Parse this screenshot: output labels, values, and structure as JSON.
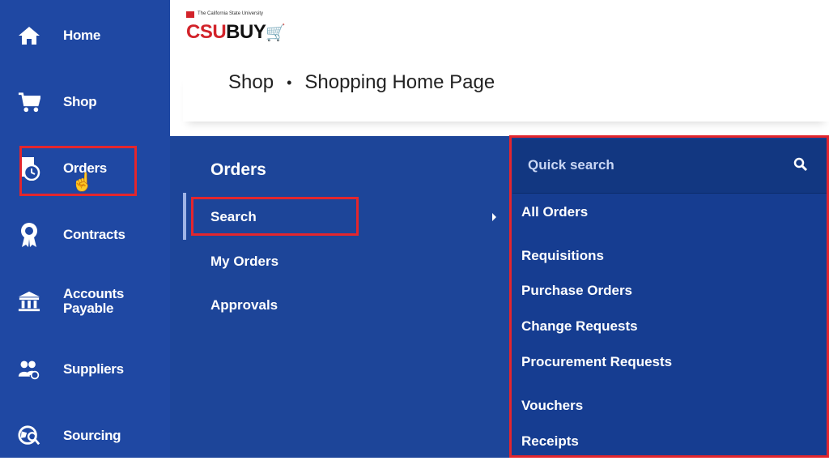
{
  "sidebar": {
    "items": [
      {
        "label": "Home",
        "icon": "home-icon"
      },
      {
        "label": "Shop",
        "icon": "cart-icon"
      },
      {
        "label": "Orders",
        "icon": "orders-clock-icon"
      },
      {
        "label": "Contracts",
        "icon": "award-ribbon-icon"
      },
      {
        "label": "Accounts Payable",
        "icon": "bank-icon"
      },
      {
        "label": "Suppliers",
        "icon": "suppliers-group-icon"
      },
      {
        "label": "Sourcing",
        "icon": "globe-search-icon"
      }
    ]
  },
  "header": {
    "logo_text_csu": "CSU",
    "logo_text_buy": "BUY",
    "logo_tagline": "The California State University",
    "breadcrumb": [
      "Shop",
      "Shopping Home Page"
    ]
  },
  "orders_menu": {
    "title": "Orders",
    "items": [
      "Search",
      "My Orders",
      "Approvals"
    ]
  },
  "flyout": {
    "search_placeholder": "Quick search",
    "items": [
      "All Orders",
      "Requisitions",
      "Purchase Orders",
      "Change Requests",
      "Procurement Requests",
      "Vouchers",
      "Receipts"
    ]
  },
  "colors": {
    "sidebar": "#1f48a3",
    "panel": "#1d4599",
    "flyout": "#163d91",
    "highlight": "#e3262d"
  }
}
